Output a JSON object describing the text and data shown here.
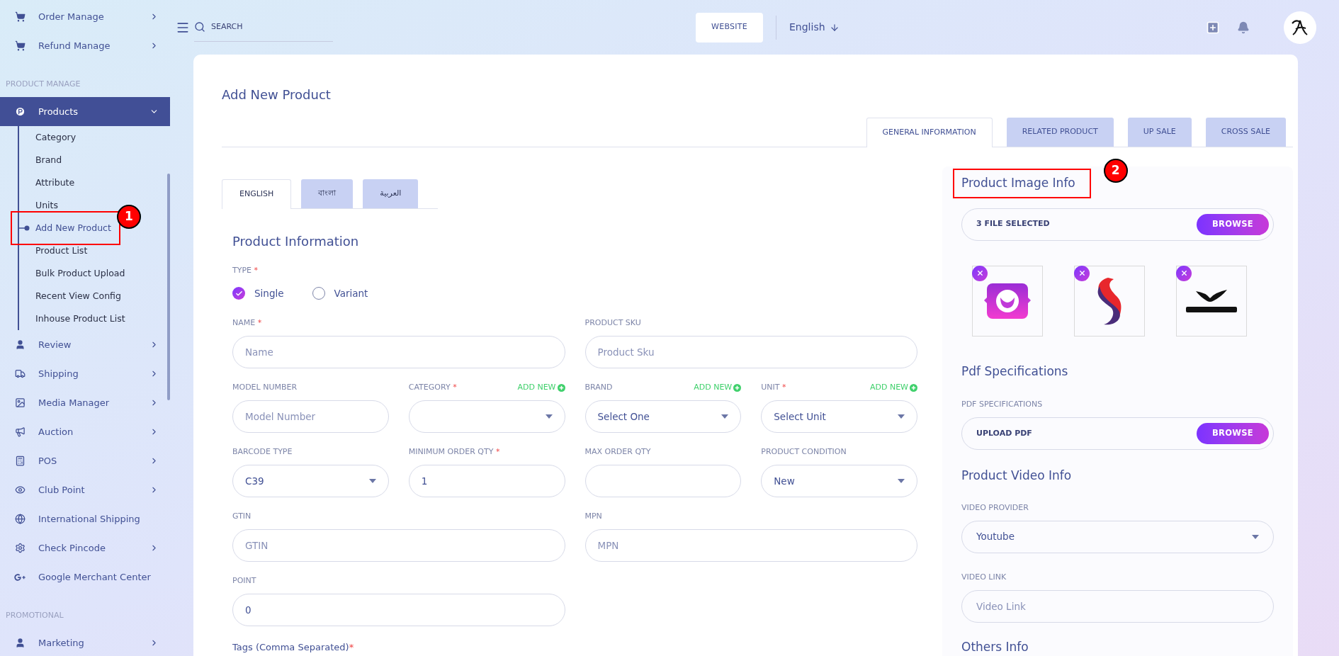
{
  "sidebar": {
    "entries": [
      {
        "kind": "item",
        "label": "Order Manage",
        "has_submenu": true,
        "expanded": false,
        "selected": false
      },
      {
        "kind": "item",
        "label": "Refund Manage",
        "has_submenu": true,
        "expanded": false,
        "selected": false
      },
      {
        "kind": "section",
        "label": "PRODUCT MANAGE"
      },
      {
        "kind": "item",
        "label": "Products",
        "has_submenu": true,
        "expanded": true,
        "selected": true,
        "children": [
          {
            "label": "Category",
            "selected": false
          },
          {
            "label": "Brand",
            "selected": false
          },
          {
            "label": "Attribute",
            "selected": false
          },
          {
            "label": "Units",
            "selected": false
          },
          {
            "label": "Add New Product",
            "selected": true,
            "callout": "1"
          },
          {
            "label": "Product List",
            "selected": false
          },
          {
            "label": "Bulk Product Upload",
            "selected": false
          },
          {
            "label": "Recent View Config",
            "selected": false
          },
          {
            "label": "Inhouse Product List",
            "selected": false
          }
        ]
      },
      {
        "kind": "item",
        "label": "Review",
        "has_submenu": true,
        "expanded": false,
        "selected": false
      },
      {
        "kind": "item",
        "label": "Shipping",
        "has_submenu": true,
        "expanded": false,
        "selected": false
      },
      {
        "kind": "item",
        "label": "Media Manager",
        "has_submenu": true,
        "expanded": false,
        "selected": false
      },
      {
        "kind": "item",
        "label": "Auction",
        "has_submenu": true,
        "expanded": false,
        "selected": false
      },
      {
        "kind": "item",
        "label": "POS",
        "has_submenu": true,
        "expanded": false,
        "selected": false
      },
      {
        "kind": "item",
        "label": "Club Point",
        "has_submenu": true,
        "expanded": false,
        "selected": false
      },
      {
        "kind": "item",
        "label": "International Shipping",
        "has_submenu": false,
        "expanded": false,
        "selected": false
      },
      {
        "kind": "item",
        "label": "Check Pincode",
        "has_submenu": true,
        "expanded": false,
        "selected": false
      },
      {
        "kind": "item",
        "label": "Google Merchant Center",
        "has_submenu": false,
        "expanded": false,
        "selected": false
      },
      {
        "kind": "section",
        "label": "PROMOTIONAL"
      },
      {
        "kind": "item",
        "label": "Marketing",
        "has_submenu": true,
        "expanded": false,
        "selected": false
      }
    ]
  },
  "header": {
    "search_placeholder": "SEARCH",
    "website_button": "WEBSITE",
    "language": "English"
  },
  "page_title": "Add New Product",
  "tabs": [
    {
      "label": "GENERAL INFORMATION",
      "selected": true
    },
    {
      "label": "RELATED PRODUCT",
      "selected": false
    },
    {
      "label": "UP SALE",
      "selected": false
    },
    {
      "label": "CROSS SALE",
      "selected": false
    }
  ],
  "language_tabs": [
    {
      "label": "ENGLISH",
      "selected": true
    },
    {
      "label": "বাংলা",
      "selected": false
    },
    {
      "label": "العربية",
      "selected": false
    }
  ],
  "product_information": {
    "title": "Product Information",
    "type_label": "TYPE",
    "type_required_mark": "*",
    "type_options": [
      {
        "label": "Single",
        "selected": true
      },
      {
        "label": "Variant",
        "selected": false
      }
    ],
    "rows": [
      [
        {
          "label": "NAME",
          "required_mark": "*",
          "kind": "input",
          "placeholder": "Name"
        },
        {
          "label": "PRODUCT SKU",
          "kind": "input",
          "placeholder": "Product Sku"
        }
      ],
      [
        {
          "label": "MODEL NUMBER",
          "kind": "input",
          "placeholder": "Model Number"
        },
        {
          "label": "CATEGORY",
          "required_mark": "*",
          "kind": "select",
          "add_new": "ADD NEW"
        },
        {
          "label": "BRAND",
          "kind": "select",
          "value": "Select One",
          "add_new": "ADD NEW"
        },
        {
          "label": "UNIT",
          "required_mark": "*",
          "kind": "select",
          "value": "Select Unit",
          "add_new": "ADD NEW"
        }
      ],
      [
        {
          "label": "BARCODE TYPE",
          "kind": "select",
          "value": "C39"
        },
        {
          "label": "MINIMUM ORDER QTY",
          "required_mark": "*",
          "kind": "input",
          "value": "1"
        },
        {
          "label": "MAX ORDER QTY",
          "kind": "input"
        },
        {
          "label": "PRODUCT CONDITION",
          "kind": "select",
          "value": "New"
        }
      ],
      [
        {
          "label": "GTIN",
          "kind": "input",
          "placeholder": "GTIN"
        },
        {
          "label": "MPN",
          "kind": "input",
          "placeholder": "MPN"
        }
      ],
      [
        {
          "label": "POINT",
          "kind": "input",
          "value": "0"
        }
      ]
    ],
    "tags_label": "Tags (Comma Separated)",
    "tags_required_mark": "*"
  },
  "image_info": {
    "title": "Product Image Info",
    "callout": "2",
    "file_text": "3 FILE SELECTED",
    "button": "BROWSE",
    "images": [
      {
        "kind": "app-logo"
      },
      {
        "kind": "swoosh-logo"
      },
      {
        "kind": "wing-logo"
      }
    ]
  },
  "pdf": {
    "title": "Pdf Specifications",
    "label": "PDF SPECIFICATIONS",
    "file_text": "UPLOAD PDF",
    "button": "BROWSE"
  },
  "video": {
    "title": "Product Video Info",
    "provider_label": "VIDEO PROVIDER",
    "provider_value": "Youtube",
    "link_label": "VIDEO LINK",
    "link_placeholder": "Video Link"
  },
  "others": {
    "title": "Others Info"
  }
}
